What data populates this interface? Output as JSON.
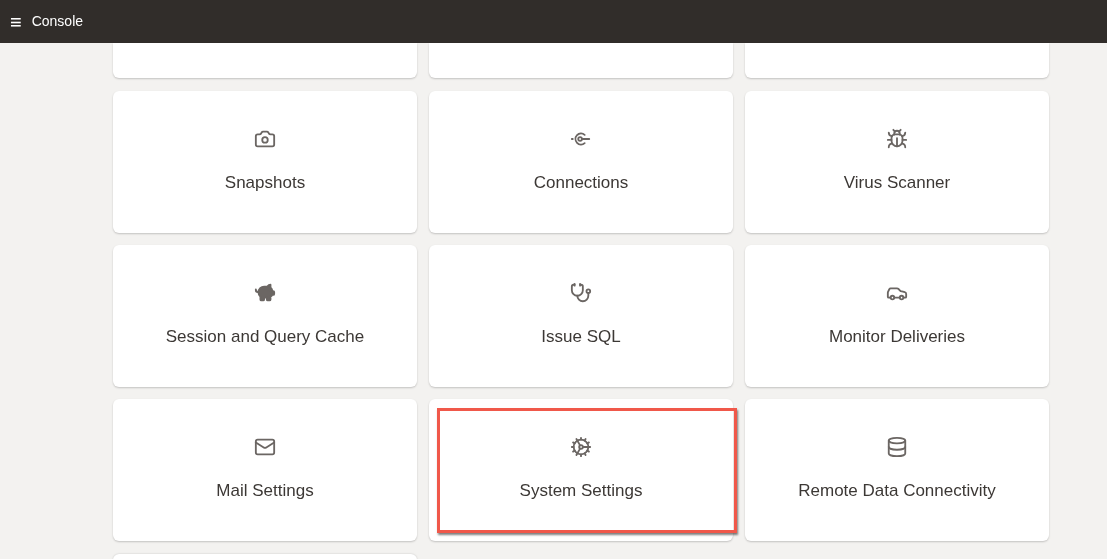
{
  "header": {
    "menu_icon": "≡",
    "title": "Console"
  },
  "cards": [
    {
      "label": "Snapshots",
      "highlighted": false
    },
    {
      "label": "Connections",
      "highlighted": false
    },
    {
      "label": "Virus Scanner",
      "highlighted": false
    },
    {
      "label": "Session and Query Cache",
      "highlighted": false
    },
    {
      "label": "Issue SQL",
      "highlighted": false
    },
    {
      "label": "Monitor Deliveries",
      "highlighted": false
    },
    {
      "label": "Mail Settings",
      "highlighted": false
    },
    {
      "label": "System Settings",
      "highlighted": true
    },
    {
      "label": "Remote Data Connectivity",
      "highlighted": false
    }
  ]
}
